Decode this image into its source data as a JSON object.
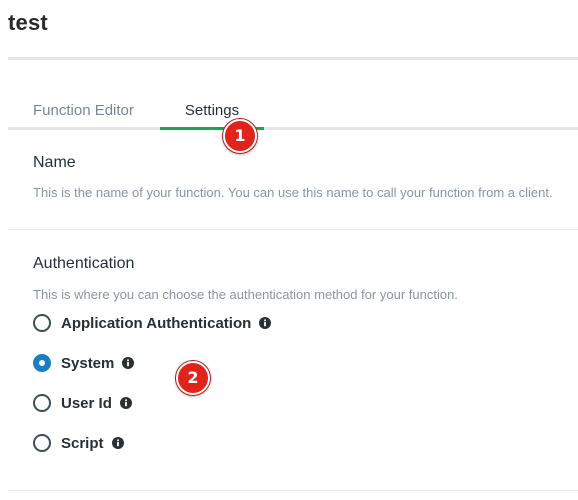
{
  "page": {
    "title": "test"
  },
  "tabs": [
    {
      "label": "Function Editor",
      "active": false
    },
    {
      "label": "Settings",
      "active": true
    }
  ],
  "annotations": {
    "badge_1": "1",
    "badge_2": "2"
  },
  "name_section": {
    "heading": "Name",
    "description": "This is the name of your function. You can use this name to call your function from a client."
  },
  "auth_section": {
    "heading": "Authentication",
    "description": "This is where you can choose the authentication method for your function.",
    "options": [
      {
        "label": "Application Authentication",
        "selected": false,
        "icon": "info-icon"
      },
      {
        "label": "System",
        "selected": true,
        "icon": "info-icon"
      },
      {
        "label": "User Id",
        "selected": false,
        "icon": "info-icon"
      },
      {
        "label": "Script",
        "selected": false,
        "icon": "info-icon"
      }
    ]
  },
  "colors": {
    "active_tab_underline": "#13aa52",
    "radio_selected": "#1a7fc1",
    "badge": "#e0241c"
  }
}
